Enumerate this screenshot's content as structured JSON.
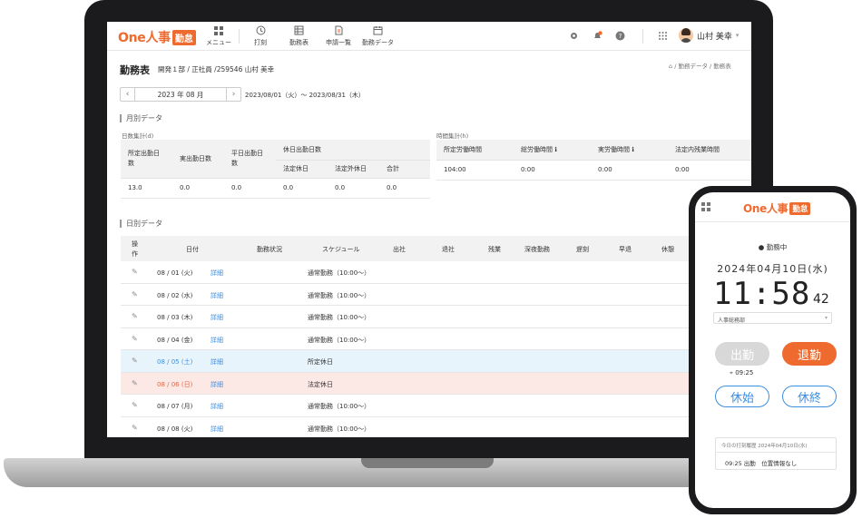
{
  "app": {
    "logo_text": "One人事",
    "logo_badge": "勤怠",
    "nav": [
      "メニュー",
      "打刻",
      "勤務表",
      "申請一覧",
      "勤務データ"
    ],
    "notification_count": "2",
    "user_name": "山村 美幸"
  },
  "page": {
    "title": "勤務表",
    "subtitle": "開発１部 / 正社員 /259546 山村 美幸",
    "breadcrumb": "勤務データ / 勤務表",
    "month": "2023 年 08 月",
    "range": "2023/08/01（火）～ 2023/08/31（木）"
  },
  "monthly": {
    "title": "月別データ",
    "days_label": "日数集計(d)",
    "hours_label": "時間集計(h)",
    "days_headers": {
      "scheduled": "所定出勤日数",
      "actual": "実出勤日数",
      "weekday": "平日出勤日数",
      "holiday_group": "休日出勤日数",
      "legal_holiday": "法定休日",
      "non_legal_holiday": "法定外休日",
      "total": "合計"
    },
    "days_values": [
      "13.0",
      "0.0",
      "0.0",
      "0.0",
      "0.0",
      "0.0"
    ],
    "hours_headers": [
      "所定労働時間",
      "総労働時間",
      "実労働時間",
      "法定内残業時間"
    ],
    "hours_values": [
      "104:00",
      "0:00",
      "0:00",
      "0:00"
    ]
  },
  "daily": {
    "title": "日別データ",
    "headers": [
      "操作",
      "日付",
      "勤務状況",
      "スケジュール",
      "出社",
      "退社",
      "残業",
      "深夜勤務",
      "遅刻",
      "早退",
      "休憩"
    ],
    "detail_label": "詳細",
    "rows": [
      {
        "date": "08 / 01 (火)",
        "schedule": "通常勤務（10:00〜）"
      },
      {
        "date": "08 / 02 (水)",
        "schedule": "通常勤務（10:00〜）"
      },
      {
        "date": "08 / 03 (木)",
        "schedule": "通常勤務（10:00〜）"
      },
      {
        "date": "08 / 04 (金)",
        "schedule": "通常勤務（10:00〜）"
      },
      {
        "date": "08 / 05 (土)",
        "schedule": "所定休日"
      },
      {
        "date": "08 / 06 (日)",
        "schedule": "法定休日"
      },
      {
        "date": "08 / 07 (月)",
        "schedule": "通常勤務（10:00〜）"
      },
      {
        "date": "08 / 08 (火)",
        "schedule": "通常勤務（10:00〜）"
      }
    ]
  },
  "phone": {
    "status": "● 勤務中",
    "date": "2024年04月10日(水)",
    "time": "11:58",
    "seconds": "42",
    "department": "人事総務部",
    "clock_in": "出勤",
    "clock_out": "退勤",
    "location_time": "09:25",
    "break_start": "休始",
    "break_end": "休終",
    "log_header": "今日の打刻履歴 2024年04月10日(水)",
    "log_entry": "09:25 出勤　位置情報なし"
  },
  "colors": {
    "brand": "#ee6a2f",
    "link": "#3d8ee0",
    "saturday_row": "#e8f4fc",
    "sunday_row": "#fce8e4"
  }
}
